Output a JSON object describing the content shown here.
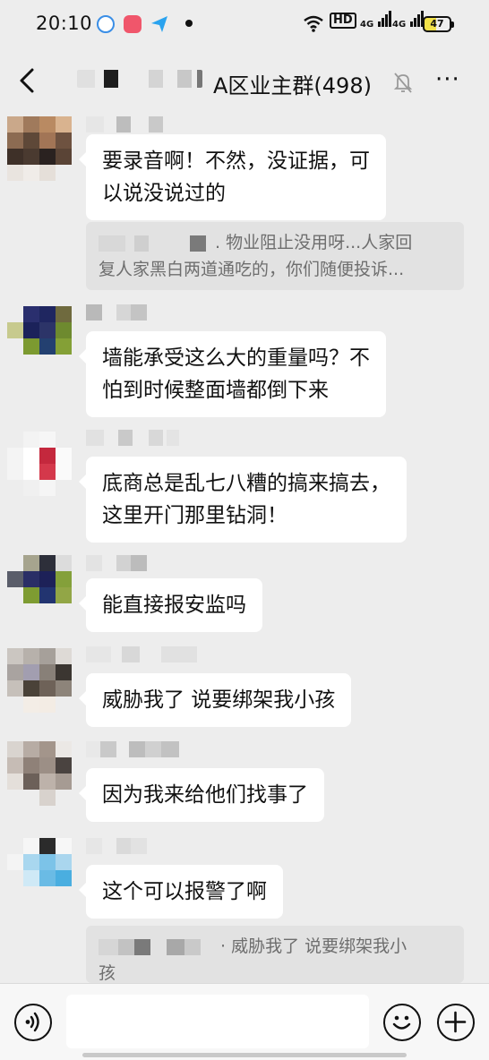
{
  "status_bar": {
    "time": "20:10",
    "network_1": "4G",
    "network_2": "4G",
    "hd_label": "HD",
    "battery": "47",
    "icons": [
      "target-app-icon",
      "grid-app-icon",
      "send-app-icon",
      "dot-icon",
      "wifi-icon",
      "hd-icon",
      "signal-icon",
      "signal-icon",
      "battery-icon"
    ]
  },
  "nav": {
    "title": "A区业主群(498)",
    "back_icon": "chevron-left-icon",
    "mute_icon": "bell-muted-icon",
    "more_label": "···"
  },
  "messages": [
    {
      "id": "m1",
      "text_line1": "要录音啊！不然，没证据，可",
      "text_line2": "以说没说过的",
      "quote_line1": ". 物业阻止没用呀...人家回",
      "quote_line2": "复人家黑白两道通吃的，你们随便投诉..."
    },
    {
      "id": "m2",
      "text_line1": "墙能承受这么大的重量吗？不",
      "text_line2": "怕到时候整面墙都倒下来"
    },
    {
      "id": "m3",
      "text_line1": "底商总是乱七八糟的搞来搞去，",
      "text_line2": "这里开门那里钻洞！"
    },
    {
      "id": "m4",
      "text_line1": "能直接报安监吗"
    },
    {
      "id": "m5",
      "text_line1": "威胁我了  说要绑架我小孩"
    },
    {
      "id": "m6",
      "text_line1": "因为我来给他们找事了"
    },
    {
      "id": "m7",
      "text_line1": "这个可以报警了啊",
      "quote_line1": "· 威胁我了  说要绑架我小",
      "quote_line2": "孩"
    }
  ],
  "input": {
    "placeholder": ""
  },
  "bottom_icons": [
    "voice-icon",
    "emoji-icon",
    "plus-icon"
  ],
  "colors": {
    "background": "#ededed",
    "bubble": "#ffffff",
    "quote_bg": "#e2e2e2",
    "quote_text": "#6e6e6e"
  }
}
